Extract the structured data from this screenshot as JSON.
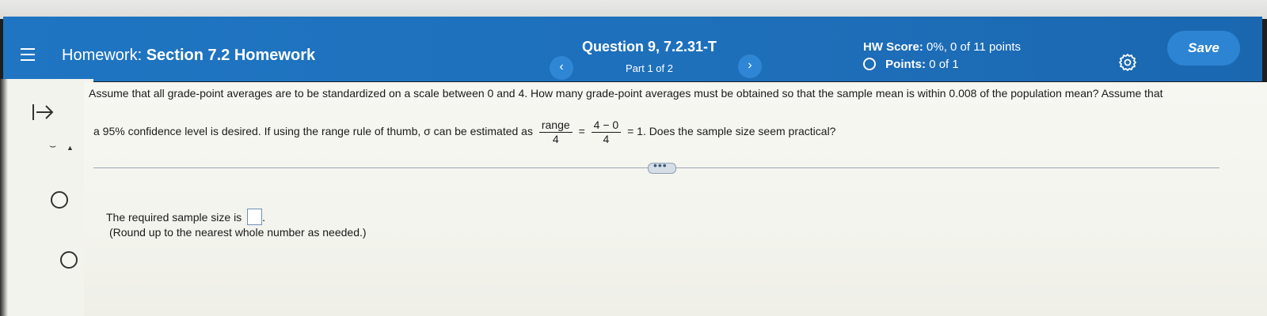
{
  "header": {
    "homework_prefix": "Homework:",
    "homework_title": "Section 7.2 Homework",
    "prev_symbol": "‹",
    "next_symbol": "›",
    "question_title": "Question 9, 7.2.31-T",
    "question_part": "Part 1 of 2",
    "score_label": "HW Score:",
    "score_value": "0%, 0 of 11 points",
    "points_label": "Points:",
    "points_value": "0 of 1",
    "save_label": "Save",
    "colors": {
      "bar": "#1f75c2",
      "save_button": "#2c84d2"
    }
  },
  "question": {
    "line1": "Assume that all grade-point averages are to be standardized on a scale between 0 and 4. How many grade-point averages must be obtained so that the sample mean is within 0.008 of the population mean? Assume that",
    "line2_start": "a 95% confidence level is desired. If using the range rule of thumb, σ can be estimated as",
    "frac1_num": "range",
    "frac1_den": "4",
    "eq1": "=",
    "frac2_num": "4 − 0",
    "frac2_den": "4",
    "line2_end": "= 1. Does the sample size seem practical?"
  },
  "answer": {
    "prompt": "The required sample size is",
    "suffix": ".",
    "hint": "(Round up to the nearest whole number as needed.)"
  },
  "rail": {
    "arrow_icon": "arrow-right-bar-icon",
    "small_glyph": "⌣"
  },
  "more_button_text": "•••"
}
